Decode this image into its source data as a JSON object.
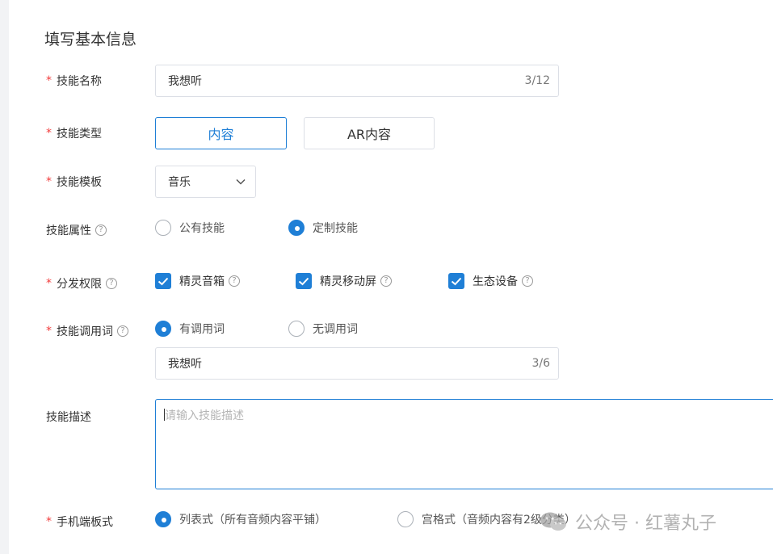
{
  "section_title": "填写基本信息",
  "fields": {
    "skill_name": {
      "label": "技能名称",
      "value": "我想听",
      "counter": "3/12",
      "required": "*"
    },
    "skill_type": {
      "label": "技能类型",
      "required": "*",
      "options": [
        "内容",
        "AR内容"
      ],
      "selected": "内容"
    },
    "skill_template": {
      "label": "技能模板",
      "required": "*",
      "value": "音乐"
    },
    "skill_attribute": {
      "label": "技能属性",
      "help": "?",
      "options": [
        "公有技能",
        "定制技能"
      ],
      "selected": "定制技能"
    },
    "distribution": {
      "label": "分发权限",
      "required": "*",
      "help": "?",
      "options": [
        "精灵音箱",
        "精灵移动屏",
        "生态设备"
      ]
    },
    "invoke_word": {
      "label": "技能调用词",
      "required": "*",
      "help": "?",
      "options": [
        "有调用词",
        "无调用词"
      ],
      "selected": "有调用词",
      "value": "我想听",
      "counter": "3/6"
    },
    "description": {
      "label": "技能描述",
      "placeholder": "请输入技能描述"
    },
    "mobile_template": {
      "label": "手机端板式",
      "required": "*",
      "options": [
        "列表式（所有音频内容平铺）",
        "宫格式（音频内容有2级分类）"
      ],
      "selected": "列表式（所有音频内容平铺）"
    }
  },
  "watermark": "公众号 · 红薯丸子",
  "colors": {
    "accent": "#1f7fd6",
    "required": "#f23c3c",
    "border": "#dcdfe6"
  },
  "icons": {
    "dropdown": "chevron-down-icon",
    "check": "check-icon",
    "help": "help-circle-icon"
  }
}
